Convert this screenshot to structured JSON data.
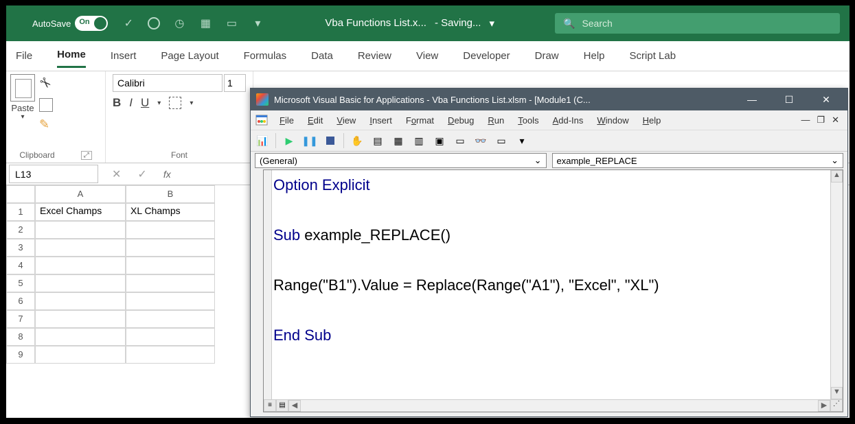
{
  "titlebar": {
    "autosave_label": "AutoSave",
    "autosave_on": "On",
    "filename": "Vba Functions List.x...",
    "status": "- Saving...",
    "search_placeholder": "Search"
  },
  "ribbon": {
    "tabs": [
      "File",
      "Home",
      "Insert",
      "Page Layout",
      "Formulas",
      "Data",
      "Review",
      "View",
      "Developer",
      "Draw",
      "Help",
      "Script Lab"
    ],
    "active_tab": "Home",
    "clipboard": {
      "paste": "Paste",
      "label": "Clipboard"
    },
    "font": {
      "name": "Calibri",
      "size": "1",
      "label": "Font",
      "bold": "B",
      "italic": "I",
      "underline": "U"
    }
  },
  "namebox": {
    "ref": "L13",
    "insert_fn": "fx"
  },
  "grid": {
    "cols": [
      "A",
      "B"
    ],
    "rows": [
      1,
      2,
      3,
      4,
      5,
      6,
      7,
      8,
      9
    ],
    "cells": {
      "A1": "Excel Champs",
      "B1": "XL Champs"
    }
  },
  "vba": {
    "title": "Microsoft Visual Basic for Applications - Vba Functions List.xlsm - [Module1 (C...",
    "menu": [
      "File",
      "Edit",
      "View",
      "Insert",
      "Format",
      "Debug",
      "Run",
      "Tools",
      "Add-Ins",
      "Window",
      "Help"
    ],
    "combo_left": "(General)",
    "combo_right": "example_REPLACE",
    "code": {
      "l1": "Option Explicit",
      "l2": "Sub",
      "l2b": " example_REPLACE()",
      "l3": "Range(\"B1\").Value = Replace(Range(\"A1\"), \"Excel\", \"XL\")",
      "l4": "End Sub"
    }
  }
}
